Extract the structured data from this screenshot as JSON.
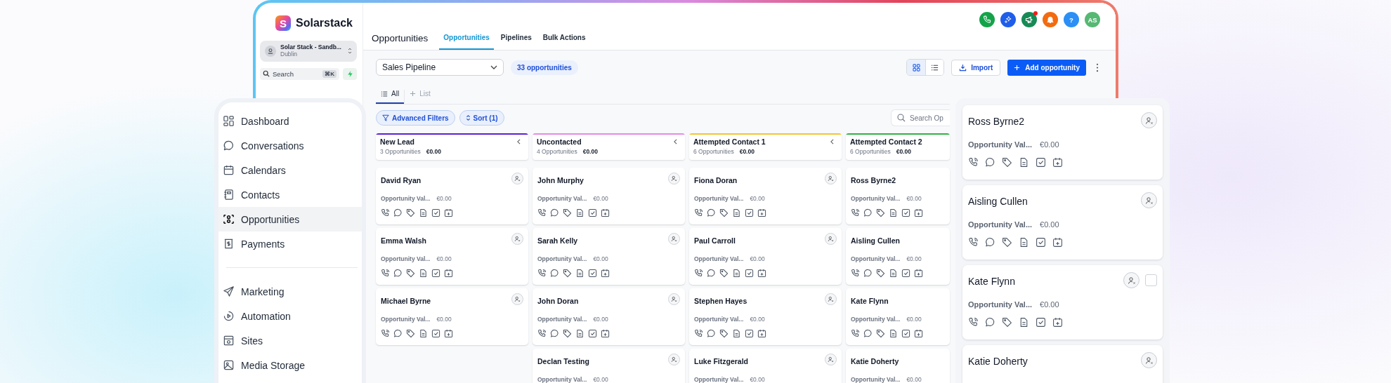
{
  "app": {
    "logo_letter": "S",
    "name": "Solarstack"
  },
  "account": {
    "name": "Solar Stack - Sandb...",
    "location": "Dublin"
  },
  "search": {
    "placeholder": "Search",
    "shortcut": "⌘K"
  },
  "page_title": "Opportunities",
  "tabs": [
    {
      "label": "Opportunities",
      "selected": true
    },
    {
      "label": "Pipelines",
      "selected": false
    },
    {
      "label": "Bulk Actions",
      "selected": false
    }
  ],
  "header_buttons": [
    {
      "kind": "phone",
      "color": "#15a34a",
      "notification": false
    },
    {
      "kind": "sparkle",
      "color": "#1f5eea",
      "notification": false
    },
    {
      "kind": "megaphone",
      "color": "#178a55",
      "notification": true
    },
    {
      "kind": "bell",
      "color": "#f36a10",
      "notification": false
    },
    {
      "kind": "help",
      "color": "#2b8ff5",
      "notification": false,
      "text": "?"
    },
    {
      "kind": "avatar",
      "color": "#55b873",
      "notification": false,
      "text": "AS"
    }
  ],
  "pipeline_select": {
    "value": "Sales Pipeline"
  },
  "count_badge": "33 opportunities",
  "view_toggle": [
    {
      "kind": "grid",
      "selected": true
    },
    {
      "kind": "list",
      "selected": false
    }
  ],
  "import_button": "Import",
  "add_button": "Add opportunity",
  "view_tabs": [
    {
      "kind": "list",
      "label": "All",
      "selected": true
    },
    {
      "kind": "add",
      "label": "List",
      "selected": false
    }
  ],
  "filters": [
    {
      "kind": "filter",
      "label": "Advanced Filters"
    },
    {
      "kind": "sort",
      "label": "Sort (1)"
    }
  ],
  "board_search": {
    "placeholder": "Search Op"
  },
  "columns": [
    {
      "title": "New Lead",
      "color": "#5b21d6",
      "count": "3 Opportunities",
      "total": "€0.00",
      "truncated": false,
      "cards": [
        {
          "name": "David Ryan",
          "value_label": "Opportunity Val...",
          "value": "€0.00"
        },
        {
          "name": "Emma Walsh",
          "value_label": "Opportunity Val...",
          "value": "€0.00"
        },
        {
          "name": "Michael Byrne",
          "value_label": "Opportunity Val...",
          "value": "€0.00"
        }
      ]
    },
    {
      "title": "Uncontacted",
      "color": "#e58ae6",
      "count": "4 Opportunities",
      "total": "€0.00",
      "truncated": false,
      "cards": [
        {
          "name": "John Murphy",
          "value_label": "Opportunity Val...",
          "value": "€0.00"
        },
        {
          "name": "Sarah Kelly",
          "value_label": "Opportunity Val...",
          "value": "€0.00"
        },
        {
          "name": "John Doran",
          "value_label": "Opportunity Val...",
          "value": "€0.00"
        },
        {
          "name": "Declan Testing",
          "value_label": "Opportunity Val...",
          "value": "€0.00"
        }
      ]
    },
    {
      "title": "Attempted Contact 1",
      "color": "#f5c431",
      "count": "6 Opportunities",
      "total": "€0.00",
      "truncated": false,
      "cards": [
        {
          "name": "Fiona Doran",
          "value_label": "Opportunity Val...",
          "value": "€0.00"
        },
        {
          "name": "Paul Carroll",
          "value_label": "Opportunity Val...",
          "value": "€0.00"
        },
        {
          "name": "Stephen Hayes",
          "value_label": "Opportunity Val...",
          "value": "€0.00"
        },
        {
          "name": "Luke Fitzgerald",
          "value_label": "Opportunity Val...",
          "value": "€0.00"
        }
      ]
    },
    {
      "title": "Attempted Contact 2",
      "color": "#2fb344",
      "count": "6 Opportunities",
      "total": "€0.00",
      "truncated": true,
      "cards": [
        {
          "name": "Ross Byrne2",
          "value_label": "Opportunity Val...",
          "value": "€0.00"
        },
        {
          "name": "Aisling Cullen",
          "value_label": "Opportunity Val...",
          "value": "€0.00"
        },
        {
          "name": "Kate Flynn",
          "value_label": "Opportunity Val...",
          "value": "€0.00"
        },
        {
          "name": "Katie Doherty",
          "value_label": "Opportunity Val...",
          "value": "€0.00"
        }
      ]
    }
  ],
  "nav": {
    "groups": [
      {
        "items": [
          {
            "kind": "dashboard",
            "label": "Dashboard",
            "selected": false
          },
          {
            "kind": "conversations",
            "label": "Conversations",
            "selected": false
          },
          {
            "kind": "calendars",
            "label": "Calendars",
            "selected": false
          },
          {
            "kind": "contacts",
            "label": "Contacts",
            "selected": false
          },
          {
            "kind": "opportunities",
            "label": "Opportunities",
            "selected": true
          },
          {
            "kind": "payments",
            "label": "Payments",
            "selected": false
          }
        ]
      },
      {
        "items": [
          {
            "kind": "marketing",
            "label": "Marketing",
            "selected": false
          },
          {
            "kind": "automation",
            "label": "Automation",
            "selected": false
          },
          {
            "kind": "sites",
            "label": "Sites",
            "selected": false
          },
          {
            "kind": "media",
            "label": "Media Storage",
            "selected": false
          }
        ]
      }
    ]
  },
  "detail_cards": [
    {
      "name": "Ross Byrne2",
      "value_label": "Opportunity Val...",
      "value": "€0.00"
    },
    {
      "name": "Aisling Cullen",
      "value_label": "Opportunity Val...",
      "value": "€0.00"
    },
    {
      "name": "Kate Flynn",
      "value_label": "Opportunity Val...",
      "value": "€0.00",
      "checkbox": {
        "checked": false
      }
    },
    {
      "name": "Katie Doherty"
    }
  ]
}
